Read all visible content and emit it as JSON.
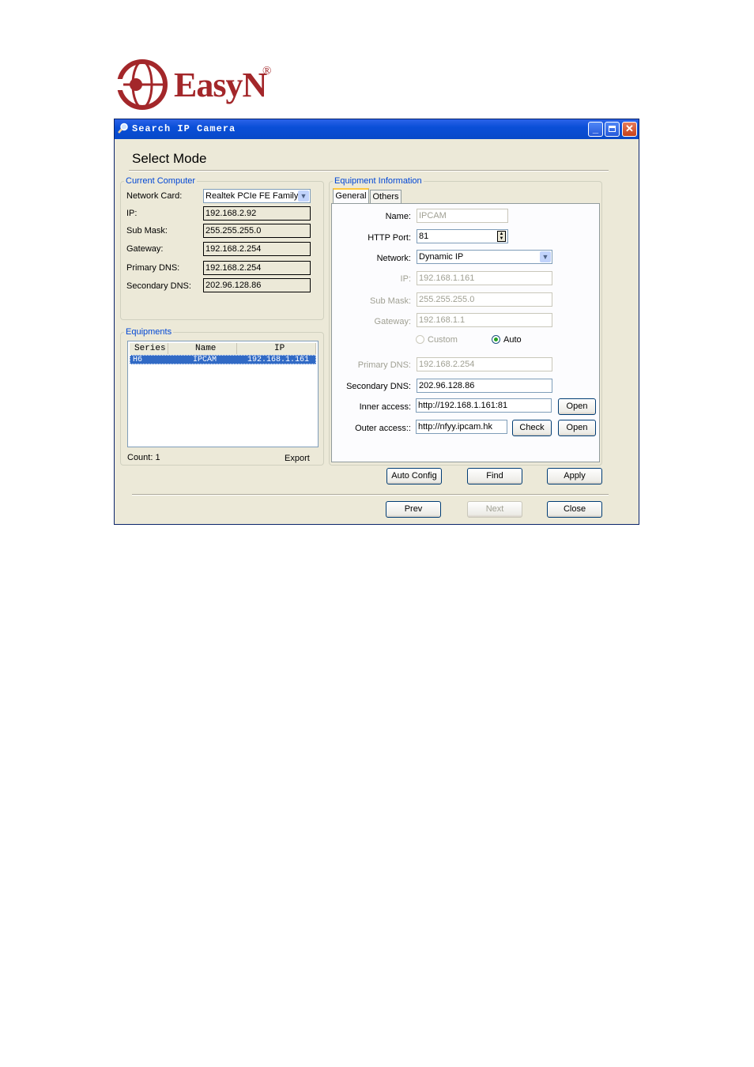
{
  "logo": {
    "text": "EasyN",
    "reg": "®"
  },
  "window": {
    "title": "Search IP Camera",
    "heading": "Select Mode"
  },
  "current_computer": {
    "group_label": "Current Computer",
    "rows": [
      {
        "label": "Network Card:",
        "value": "Realtek PCIe FE Family C"
      },
      {
        "label": "IP:",
        "value": "192.168.2.92"
      },
      {
        "label": "Sub Mask:",
        "value": "255.255.255.0"
      },
      {
        "label": "Gateway:",
        "value": "192.168.2.254"
      },
      {
        "label": "Primary DNS:",
        "value": "192.168.2.254"
      },
      {
        "label": "Secondary DNS:",
        "value": "202.96.128.86"
      }
    ]
  },
  "equipments": {
    "group_label": "Equipments",
    "columns": [
      "Series",
      "Name",
      "IP"
    ],
    "rows": [
      {
        "series": "H6",
        "name": "IPCAM",
        "ip": "192.168.1.161"
      }
    ],
    "count_label": "Count: 1",
    "export_label": "Export"
  },
  "equipment_info": {
    "group_label": "Equipment Information",
    "tabs": [
      "General",
      "Others"
    ],
    "name_label": "Name:",
    "name_value": "IPCAM",
    "http_port_label": "HTTP Port:",
    "http_port_value": "81",
    "network_label": "Network:",
    "network_value": "Dynamic IP",
    "ip_label": "IP:",
    "ip_value": "192.168.1.161",
    "submask_label": "Sub Mask:",
    "submask_value": "255.255.255.0",
    "gateway_label": "Gateway:",
    "gateway_value": "192.168.1.1",
    "radio_custom": "Custom",
    "radio_auto": "Auto",
    "primary_dns_label": "Primary DNS:",
    "primary_dns_value": "192.168.2.254",
    "secondary_dns_label": "Secondary DNS:",
    "secondary_dns_value": "202.96.128.86",
    "inner_access_label": "Inner access:",
    "inner_access_value": "http://192.168.1.161:81",
    "outer_access_label": "Outer access::",
    "outer_access_value": "http://nfyy.ipcam.hk",
    "open_label": "Open",
    "check_label": "Check"
  },
  "buttons": {
    "auto_config": "Auto Config",
    "find": "Find",
    "apply": "Apply",
    "prev": "Prev",
    "next": "Next",
    "close": "Close"
  }
}
